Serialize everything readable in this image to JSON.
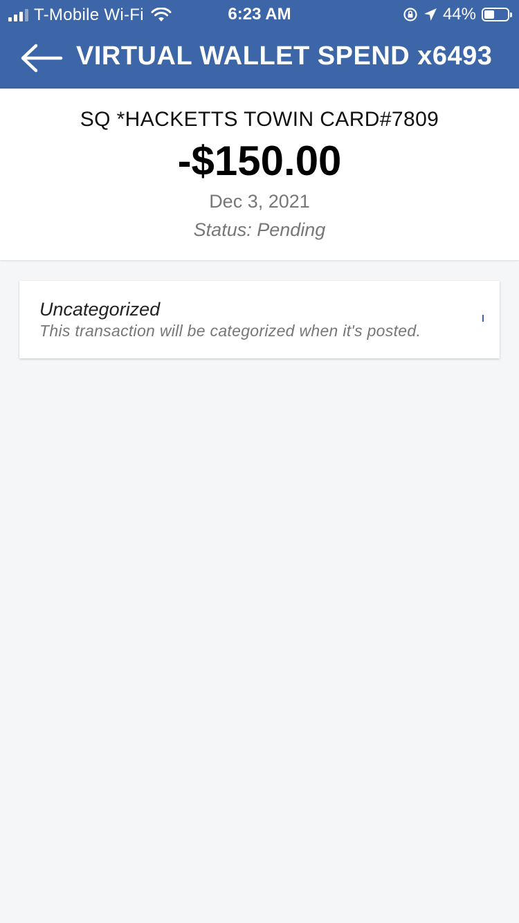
{
  "status_bar": {
    "carrier": "T-Mobile Wi-Fi",
    "time": "6:23 AM",
    "battery_percent": "44%",
    "battery_level": 0.44,
    "icons": [
      "signal-icon",
      "wifi-icon",
      "rotation-lock-icon",
      "location-arrow-icon",
      "battery-icon"
    ]
  },
  "nav": {
    "back_icon": "arrow-left-icon",
    "title": "VIRTUAL WALLET SPEND x6493"
  },
  "transaction": {
    "merchant": "SQ *HACKETTS TOWIN CARD#7809",
    "amount": "-$150.00",
    "date": "Dec 3, 2021",
    "status": "Status: Pending"
  },
  "category": {
    "title": "Uncategorized",
    "subtitle": "This transaction will be categorized when it's posted."
  },
  "colors": {
    "header": "#3c66a8",
    "background": "#f5f6f8",
    "muted_text": "#777777"
  }
}
